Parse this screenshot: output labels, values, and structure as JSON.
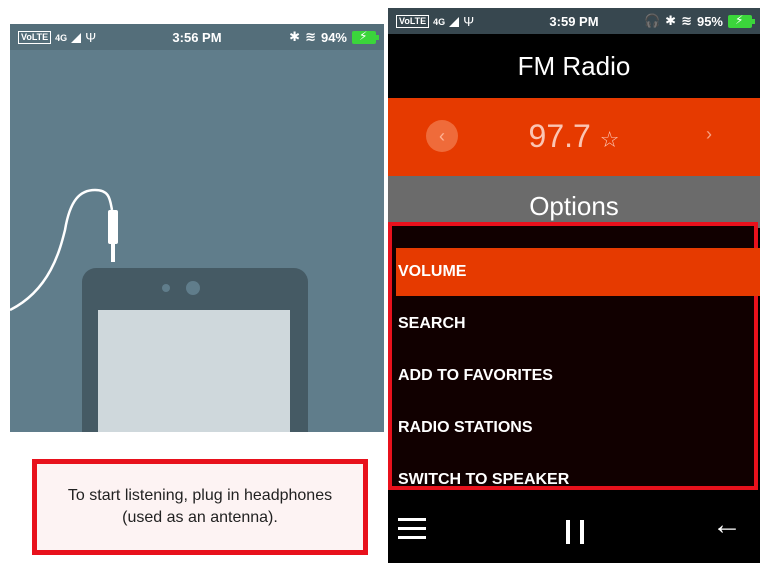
{
  "left": {
    "status": {
      "network": "VoLTE",
      "signal_label": "4G",
      "time": "3:56 PM",
      "battery": "94%"
    },
    "notice_text": "To start listening, plug in headphones (used as an antenna)."
  },
  "right": {
    "status": {
      "network": "VoLTE",
      "signal_label": "4G",
      "time": "3:59 PM",
      "battery": "95%"
    },
    "title": "FM Radio",
    "frequency": "97.7",
    "options_label": "Options",
    "menu": [
      {
        "label": "VOLUME",
        "active": true
      },
      {
        "label": "SEARCH",
        "active": false
      },
      {
        "label": "ADD TO FAVORITES",
        "active": false
      },
      {
        "label": "RADIO STATIONS",
        "active": false
      },
      {
        "label": "SWITCH TO SPEAKER",
        "active": false
      }
    ]
  },
  "icons": {
    "prev": "chevron-left-icon",
    "next": "chevron-right-icon",
    "favorite": "star-icon",
    "menu": "hamburger-icon",
    "pause": "pause-icon",
    "back": "back-arrow-icon"
  },
  "colors": {
    "accent": "#e63a00",
    "highlight_box": "#e8111c",
    "illustration_bg": "#607d8b",
    "battery": "#3bd53b"
  }
}
